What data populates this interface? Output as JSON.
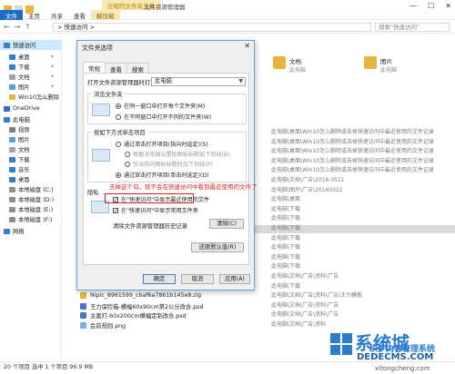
{
  "window": {
    "context_tools": "压缩的文件夹工具",
    "title": "文件资源管理器",
    "tabs": [
      "文件",
      "主页",
      "共享",
      "查看",
      "解压缩"
    ],
    "minimize": "—",
    "maximize": "☐",
    "close": "✕"
  },
  "address": {
    "path": "> 快速访问 >",
    "search_placeholder": "搜索\"快速访问\""
  },
  "sidebar": {
    "items": [
      {
        "label": "快速访问",
        "selected": true,
        "color": "#3a7bd5"
      },
      {
        "label": "桌面",
        "color": "#2f80d0"
      },
      {
        "label": "下载",
        "color": "#2f80d0"
      },
      {
        "label": "文档",
        "color": "#9aa5b1"
      },
      {
        "label": "图片",
        "color": "#5aa0e0"
      },
      {
        "label": "Win10怎么删除",
        "color": "#e8b440"
      },
      {
        "label": "OneDrive",
        "color": "#2b6ed6"
      },
      {
        "label": "此电脑",
        "color": "#3a7bd5"
      },
      {
        "label": "视频",
        "color": "#7a7f87"
      },
      {
        "label": "图片",
        "color": "#5aa0e0"
      },
      {
        "label": "文档",
        "color": "#9aa5b1"
      },
      {
        "label": "下载",
        "color": "#2f80d0"
      },
      {
        "label": "音乐",
        "color": "#2f80d0"
      },
      {
        "label": "桌面",
        "color": "#2f80d0"
      },
      {
        "label": "本地磁盘 (C:)",
        "color": "#8a9099"
      },
      {
        "label": "本地磁盘 (D:)",
        "color": "#8a9099"
      },
      {
        "label": "本地磁盘 (E:)",
        "color": "#8a9099"
      },
      {
        "label": "本地磁盘 (F:)",
        "color": "#8a9099"
      },
      {
        "label": "网络",
        "color": "#3a7bd5"
      }
    ]
  },
  "pane": {
    "tiles": [
      {
        "title": "文档",
        "sub": "此电脑"
      },
      {
        "title": "图片",
        "sub": "此电脑"
      }
    ],
    "recent_paths": [
      "此电脑\\桌面\\Win10怎么删除或去掉快速访问中最近使用的文件记录",
      "此电脑\\桌面\\Win10怎么删除或去掉快速访问中最近使用的文件记录",
      "此电脑\\桌面\\Win10怎么删除或去掉快速访问中最近使用的文件记录",
      "此电脑\\桌面\\Win10怎么删除或去掉快速访问中最近使用的文件记录",
      "此电脑\\桌面\\Win10怎么删除或去掉快速访问中最近使用的文件记录",
      "此电脑\\文档\\广告\\2016.0521",
      "此电脑\\图片\\广告\\20160322",
      "此电脑\\桌面",
      "此电脑\\下载",
      "此电脑\\下载",
      "此电脑\\下载",
      "此电脑\\下载",
      "此电脑\\下载",
      "此电脑\\下载",
      "此电脑\\下载",
      "此电脑\\文档\\广告\\资料\\广告",
      "此电脑\\下载",
      "此电脑\\文档\\广告\\资料\\广告\\王力模板",
      "此电脑\\文档\\广告\\资料\\广告",
      "此电脑\\文档\\广告\\资料\\广告",
      "此电脑\\文档\\广告\\资料"
    ],
    "files": [
      "Nipic_8961599_cbaf6a7861b145e8.zip",
      "王力保险箱-横幅60x90cm第2公分改合.psd",
      "主案打-60x200cm横幅定制改合.psd",
      "会前规则.png"
    ]
  },
  "status": {
    "text": "20 个项目    选中 1 个项目  96.9 MB"
  },
  "dialog": {
    "title": "文件夹选项",
    "close": "✕",
    "tabs": [
      "常规",
      "查看",
      "搜索"
    ],
    "open_label": "打开文件资源管理器时打开:",
    "open_value": "此电脑",
    "browse_group": "浏览文件夹",
    "browse_options": [
      "在同一窗口中打开每个文件夹(M)",
      "在不同窗口中打开不同的文件夹(W)"
    ],
    "click_group": "按如下方式单击项目",
    "click_options": [
      "通过单击打开项目(指向时选定)(S)",
      "根据浏览器设置给图标标题加下划线(B)",
      "仅当指向图标标题时加下划线(P)",
      "通过双击打开项目(单击时选定)(D)"
    ],
    "privacy_group": "隐私",
    "privacy_options": [
      "在\"快速访问\"中显示最近使用的文件",
      "在\"快速访问\"中显示常用文件夹"
    ],
    "clear_label": "清除文件资源管理器历史记录",
    "clear_button": "清除(C)",
    "restore_button": "还原默认值(R)",
    "ok_button": "确定",
    "cancel_button": "取消",
    "apply_button": "应用(A)"
  },
  "annotation": {
    "text": "去掉这个勾，就不会在快速访问中看到最近使用的文件了"
  },
  "watermark": {
    "brand": "系统城",
    "site": "DEDECMS.COM",
    "sub": "织梦内容管理系统",
    "url": "xitongcheng.com"
  }
}
